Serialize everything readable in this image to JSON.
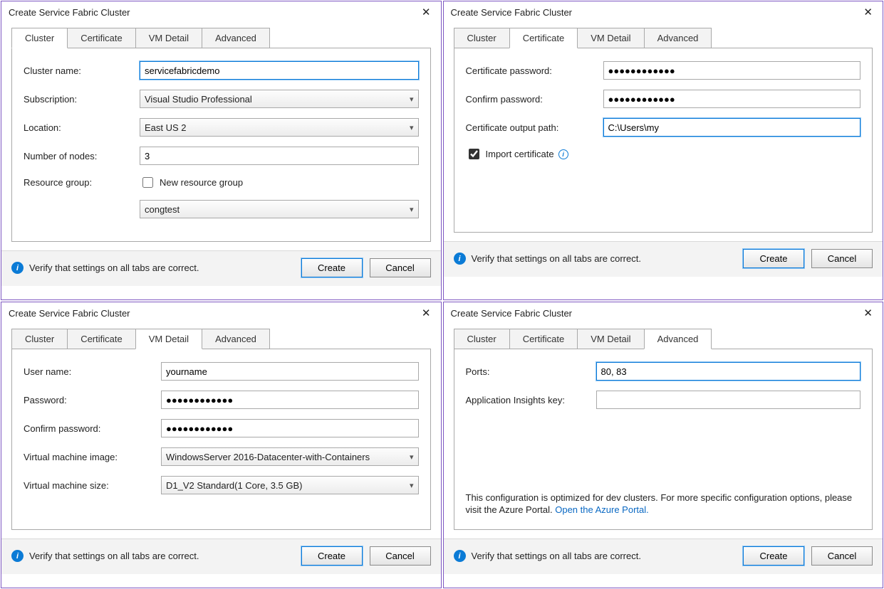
{
  "tabs": {
    "cluster": "Cluster",
    "certificate": "Certificate",
    "vm": "VM Detail",
    "advanced": "Advanced"
  },
  "dlgA": {
    "title": "Create Service Fabric Cluster",
    "labels": {
      "cluster_name": "Cluster name:",
      "subscription": "Subscription:",
      "location": "Location:",
      "nodes": "Number of nodes:",
      "rg": "Resource group:",
      "new_rg": "New resource group"
    },
    "values": {
      "cluster_name": "servicefabricdemo",
      "subscription": "Visual Studio Professional",
      "location": "East US 2",
      "nodes": "3",
      "rg": "congtest",
      "new_rg_checked": false
    },
    "footer_msg": "Verify that settings on all tabs are correct.",
    "create": "Create",
    "cancel": "Cancel"
  },
  "dlgB": {
    "title": "Create Service Fabric Cluster",
    "labels": {
      "cert_pw": "Certificate password:",
      "confirm": "Confirm password:",
      "out_path": "Certificate output path:",
      "import": "Import certificate"
    },
    "values": {
      "cert_pw": "●●●●●●●●●●●●",
      "confirm": "●●●●●●●●●●●●",
      "out_path": "C:\\Users\\my",
      "import_checked": true
    },
    "footer_msg": "Verify that settings on all tabs are correct.",
    "create": "Create",
    "cancel": "Cancel"
  },
  "dlgC": {
    "title": "Create Service Fabric Cluster",
    "labels": {
      "user": "User name:",
      "password": "Password:",
      "confirm": "Confirm password:",
      "vmimg": "Virtual machine image:",
      "vmsize": "Virtual machine size:"
    },
    "values": {
      "user": "yourname",
      "password": "●●●●●●●●●●●●",
      "confirm": "●●●●●●●●●●●●",
      "vmimg": "WindowsServer 2016-Datacenter-with-Containers",
      "vmsize": "D1_V2 Standard(1 Core, 3.5 GB)"
    },
    "footer_msg": "Verify that settings on all tabs are correct.",
    "create": "Create",
    "cancel": "Cancel"
  },
  "dlgD": {
    "title": "Create Service Fabric Cluster",
    "labels": {
      "ports": "Ports:",
      "ai_key": "Application Insights key:"
    },
    "values": {
      "ports": "80, 83",
      "ai_key": ""
    },
    "hint_pre": "This configuration is optimized for dev clusters. For more specific configuration options, please visit the Azure Portal. ",
    "hint_link": "Open the Azure Portal.",
    "footer_msg": "Verify that settings on all tabs are correct.",
    "create": "Create",
    "cancel": "Cancel"
  }
}
